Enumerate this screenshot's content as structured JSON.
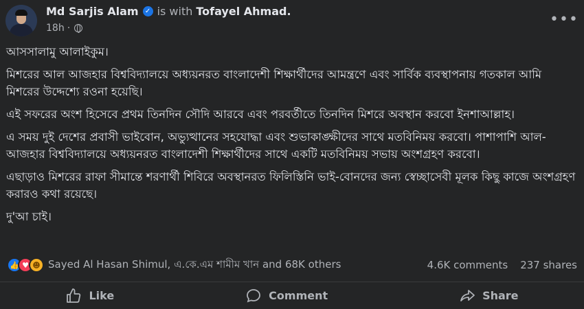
{
  "author": {
    "name": "Md Sarjis Alam",
    "verified_icon": "verified-badge-icon",
    "with_text": "is with",
    "tagged": "Tofayel Ahmad."
  },
  "meta": {
    "time": "18h",
    "separator": "·",
    "audience_icon": "globe-icon"
  },
  "more_label": "•••",
  "post": {
    "paragraphs": [
      "আসসালামু আলাইকুম।",
      "মিশরের আল আজহার বিশ্ববিদ্যালয়ে অধ্যয়নরত বাংলাদেশী শিক্ষার্থীদের আমন্ত্রণে এবং সার্বিক ব্যবস্থাপনায় গতকাল আমি মিশরের উদ্দেশ্যে রওনা হয়েছি।",
      "এই সফরের অংশ হিসেবে প্রথম তিনদিন সৌদি আরবে এবং পরবর্তীতে তিনদিন মিশরে অবস্থান করবো ইনশাআল্লাহ।",
      "এ সময় দুই দেশের প্রবাসী ভাইবোন, অভ্যুত্থানের সহযোদ্ধা এবং শুভাকাঙ্ক্ষীদের সাথে মতবিনিময় করবো। পাশাপাশি আল-আজহার বিশ্ববিদ্যালয়ে অধ্যয়নরত বাংলাদেশী শিক্ষার্থীদের সাথে একটি মতবিনিময় সভায় অংশগ্রহণ করবো।",
      "এছাড়াও মিশরের রাফা সীমান্তে শরণার্থী শিবিরে অবস্থানরত ফিলিস্তিনি ভাই-বোনদের জন্য স্বেচ্ছাসেবী মূলক কিছু কাজে অংশগ্রহণ করারও কথা রয়েছে।",
      "দু'আ চাই।"
    ]
  },
  "reactions": {
    "icons": [
      "like-reaction-icon",
      "love-reaction-icon",
      "care-reaction-icon"
    ],
    "names": "Sayed Al Hasan Shimul, এ.কে.এম শামীম খান and 68K others",
    "comments": "4.6K comments",
    "shares": "237 shares"
  },
  "actions": {
    "like": "Like",
    "comment": "Comment",
    "share": "Share"
  },
  "colors": {
    "background": "#242526",
    "text": "#e4e6eb",
    "secondary": "#b0b3b8",
    "like_blue": "#1877f2",
    "love_red": "#f33e58",
    "care_yellow": "#f7b125"
  }
}
